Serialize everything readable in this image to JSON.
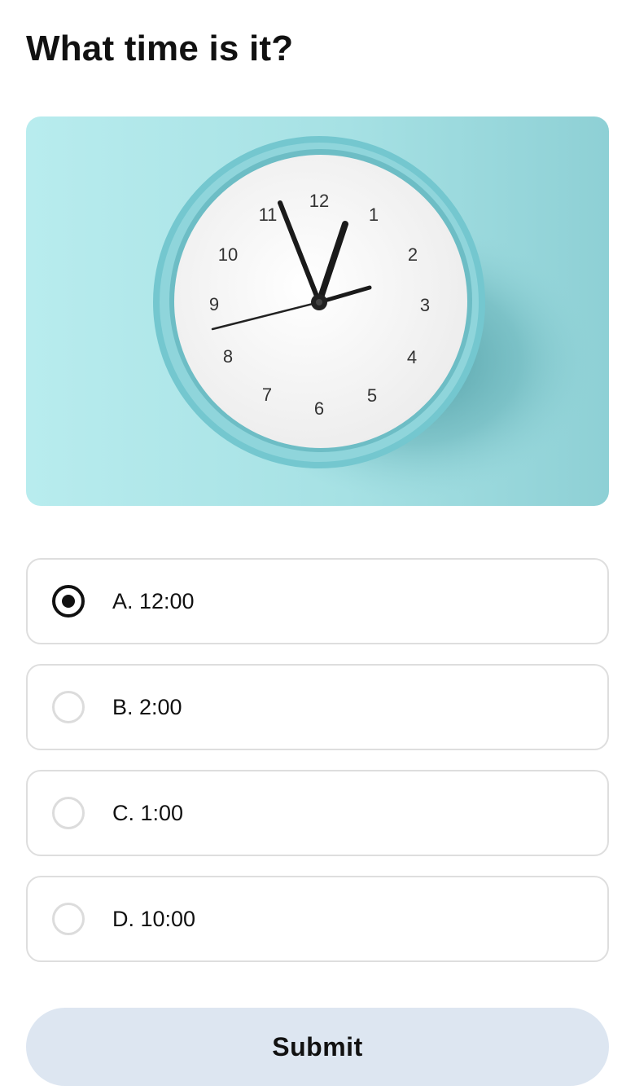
{
  "question": {
    "title": "What time is it?"
  },
  "clock_image": {
    "subject": "analog wall clock",
    "background_color": "#9fdde0",
    "dial_numbers": [
      "12",
      "1",
      "2",
      "3",
      "4",
      "5",
      "6",
      "7",
      "8",
      "9",
      "10",
      "11"
    ],
    "time_shown": {
      "hour_hand_points_to": 1,
      "minute_hand_points_to": 11
    }
  },
  "options": [
    {
      "label": "A. 12:00",
      "selected": true
    },
    {
      "label": "B. 2:00",
      "selected": false
    },
    {
      "label": "C. 1:00",
      "selected": false
    },
    {
      "label": "D. 10:00",
      "selected": false
    }
  ],
  "submit_label": "Submit",
  "colors": {
    "submit_background": "#dde6f1",
    "option_border": "#dedede",
    "selected_radio": "#111111",
    "clock_rim": "#6fc3cb"
  }
}
